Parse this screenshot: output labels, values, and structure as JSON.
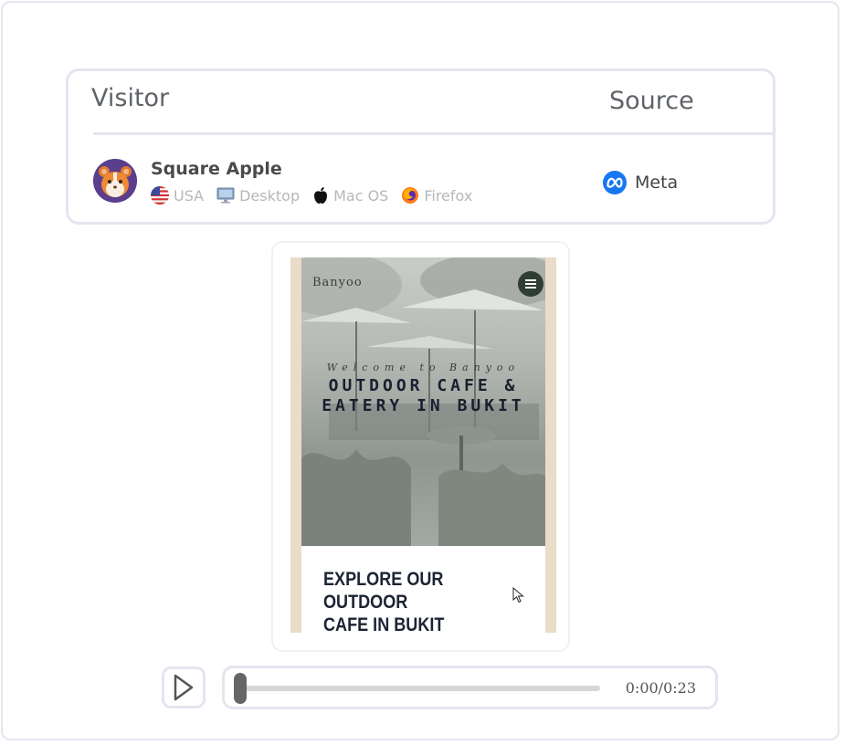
{
  "card": {
    "visitor_header": "Visitor",
    "source_header": "Source",
    "visitor": {
      "name": "Square Apple",
      "country": "USA",
      "device": "Desktop",
      "os": "Mac OS",
      "browser": "Firefox"
    },
    "source": {
      "label": "Meta",
      "icon": "meta-icon"
    }
  },
  "preview": {
    "brand": "Banyoo",
    "welcome": "Welcome to Banyoo",
    "hero_title_line1": "OUTDOOR CAFE &",
    "hero_title_line2": "EATERY IN BUKIT",
    "section_title_line1": "EXPLORE OUR OUTDOOR",
    "section_title_line2": "CAFE IN BUKIT",
    "accent_color": "#2f3d33"
  },
  "player": {
    "time": "0:00/0:23",
    "progress": 0
  }
}
